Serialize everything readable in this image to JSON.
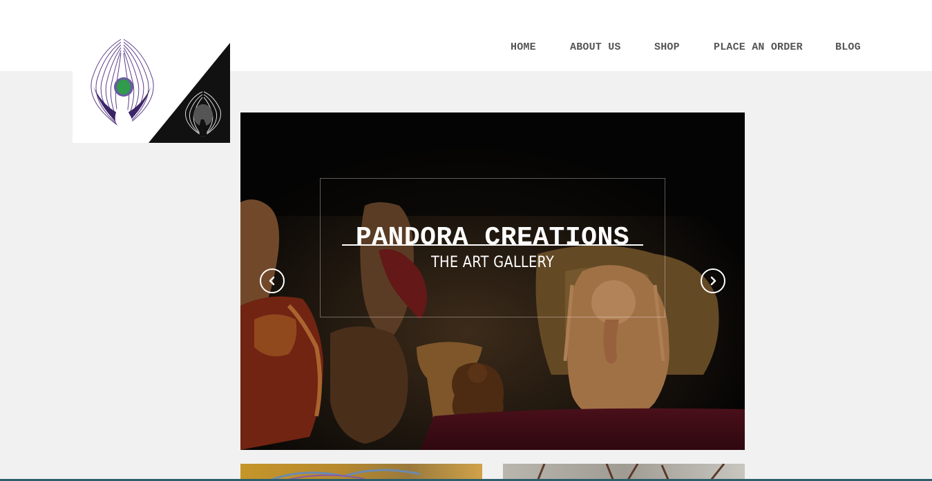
{
  "nav": {
    "items": [
      {
        "label": "HOME"
      },
      {
        "label": "ABOUT US"
      },
      {
        "label": "SHOP"
      },
      {
        "label": "PLACE AN ORDER"
      },
      {
        "label": "BLOG"
      }
    ]
  },
  "hero": {
    "title": "PANDORA CREATIONS",
    "subtitle": "THE ART GALLERY",
    "prev_icon": "chevron-left-icon",
    "next_icon": "chevron-right-icon"
  },
  "logo": {
    "icon": "peacock-logo-icon"
  },
  "colors": {
    "header_bg": "#ffffff",
    "page_bg": "#f1f1f1",
    "nav_text": "#555555",
    "peacock_purple": "#4b2a7a",
    "peacock_green": "#2e9a4a"
  }
}
